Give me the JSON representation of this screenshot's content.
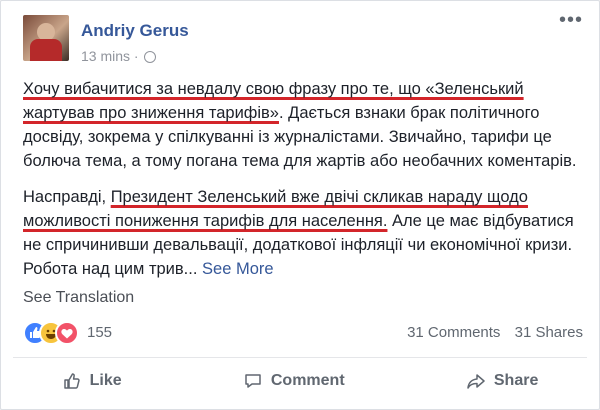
{
  "post": {
    "author": "Andriy Gerus",
    "time": "13 mins ·",
    "more_label": "•••",
    "paragraph1": [
      {
        "text": "Хочу вибачитися за невдалу свою фразу про те, що «Зеленський жартував про зниження тарифів»",
        "underline": true
      },
      {
        "text": ". Дається взнаки брак політичного досвіду, зокрема у спілкуванні із журналістами. Звичайно, тарифи це болюча тема, а тому погана тема для жартів або необачних коментарів.",
        "underline": false
      }
    ],
    "paragraph2": [
      {
        "text": "Насправді, ",
        "underline": false
      },
      {
        "text": "Президент Зеленський вже двічі скликав нараду щодо можливості пониження тарифів для населення.",
        "underline": true
      },
      {
        "text": " Але це має відбуватися не спричинивши девальвації, додаткової інфляції чи економічної кризи. Робота над цим трив...",
        "underline": false
      }
    ],
    "see_more": "See More",
    "see_translation": "See Translation"
  },
  "stats": {
    "reaction_count": "155",
    "comments": "31 Comments",
    "shares": "31 Shares",
    "reactions": [
      "like-icon",
      "haha-icon",
      "love-icon"
    ]
  },
  "actions": {
    "like": "Like",
    "comment": "Comment",
    "share": "Share"
  },
  "colors": {
    "link": "#365899",
    "underline": "#d3252a",
    "like": "#4080ff",
    "love": "#f25268",
    "haha": "#f7c43d"
  }
}
